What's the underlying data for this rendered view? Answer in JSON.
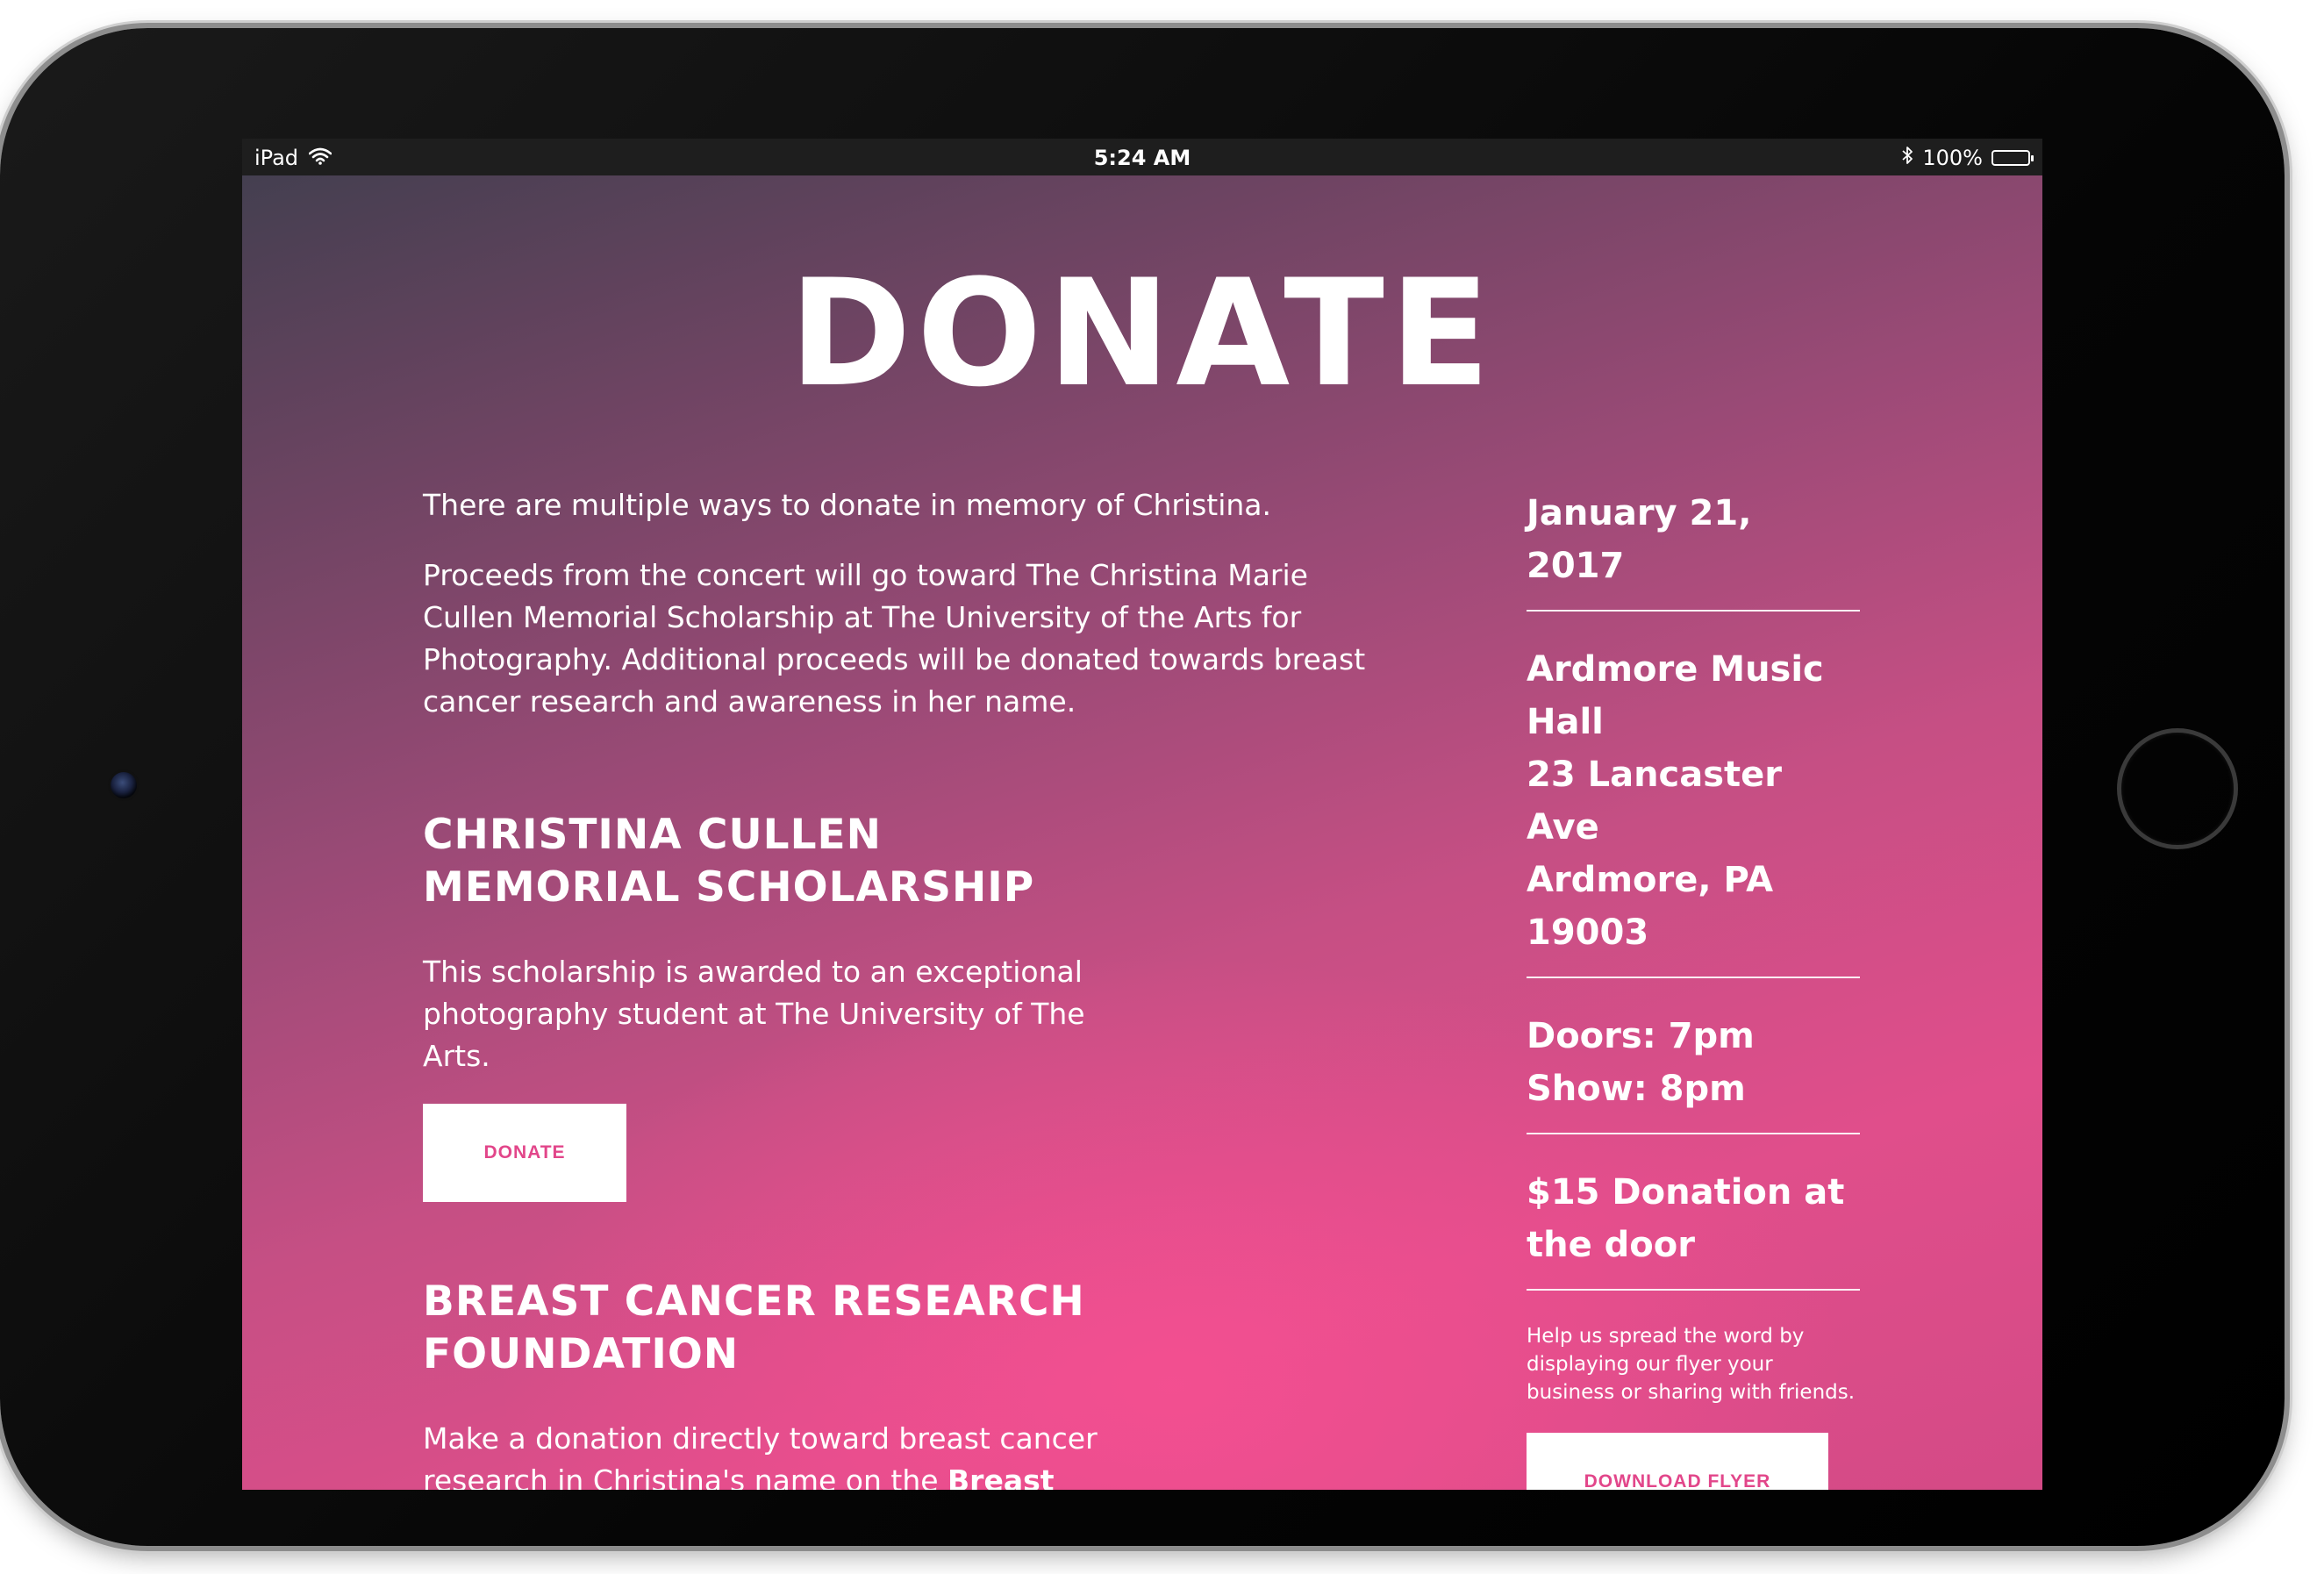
{
  "status_bar": {
    "device": "iPad",
    "time": "5:24 AM",
    "battery": "100%"
  },
  "page": {
    "title": "DONATE",
    "intro": "There are multiple ways to donate in memory of Christina.",
    "proceeds": "Proceeds from the concert will go toward The Christina Marie Cullen Memorial Scholarship at The University of the Arts for Photography. Additional proceeds will be donated towards breast cancer research and awareness in her name."
  },
  "scholarship": {
    "heading": "CHRISTINA CULLEN MEMORIAL SCHOLARSHIP",
    "body": "This scholarship is awarded to an exceptional photography student at The University of The Arts.",
    "button": "DONATE"
  },
  "research": {
    "heading": "BREAST CANCER RESEARCH FOUNDATION",
    "body_prefix": "Make a donation directly toward breast cancer research in Christina's name on the ",
    "body_bold": "Breast Cancer Research Foundation's Time For Research"
  },
  "event": {
    "date": "January 21, 2017",
    "venue_name": "Ardmore Music Hall",
    "address_line1": "23 Lancaster Ave",
    "address_line2": "Ardmore, PA 19003",
    "doors": "Doors: 7pm",
    "show": "Show: 8pm",
    "donation": "$15 Donation at the door",
    "spread_word": "Help us spread the word by displaying our flyer your business or sharing with friends.",
    "flyer_button": "DOWNLOAD FLYER"
  },
  "colors": {
    "accent": "#e2468a",
    "status_bar": "#1e1e1e",
    "text": "#ffffff"
  },
  "icons": [
    "wifi-icon",
    "bluetooth-icon",
    "battery-icon"
  ]
}
